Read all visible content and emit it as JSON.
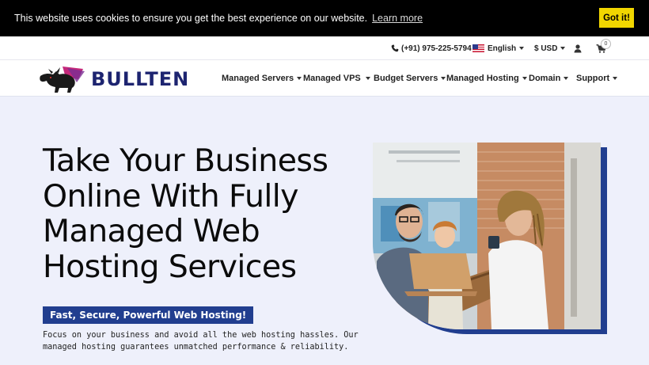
{
  "cookie": {
    "message": "This website uses cookies to ensure you get the best experience on our website.",
    "learn_more": "Learn more",
    "button": "Got it!"
  },
  "topbar": {
    "phone": "(+91) 975-225-5794",
    "language": "English",
    "currency": "$ USD",
    "cart_count": "0"
  },
  "brand": {
    "name": "BULLTEN"
  },
  "nav": {
    "items": [
      {
        "label": "Managed Servers"
      },
      {
        "label": "Managed VPS"
      },
      {
        "label": "Budget Servers"
      },
      {
        "label": "Managed Hosting"
      },
      {
        "label": "Domain"
      },
      {
        "label": "Support"
      }
    ]
  },
  "hero": {
    "title_lines": [
      "Take Your Business",
      "Online With Fully",
      "Managed Web",
      "Hosting Services"
    ],
    "badge": "Fast, Secure, Powerful Web Hosting!",
    "description": "Focus on your business and avoid all the web hosting hassles. Our managed hosting guarantees unmatched performance & reliability."
  },
  "colors": {
    "accent_blue": "#213e8f",
    "cookie_button": "#f1d600",
    "hero_background": "#eef0fb"
  },
  "icons": [
    "phone-icon",
    "us-flag-icon",
    "user-icon",
    "cart-icon",
    "bull-logo-icon"
  ]
}
